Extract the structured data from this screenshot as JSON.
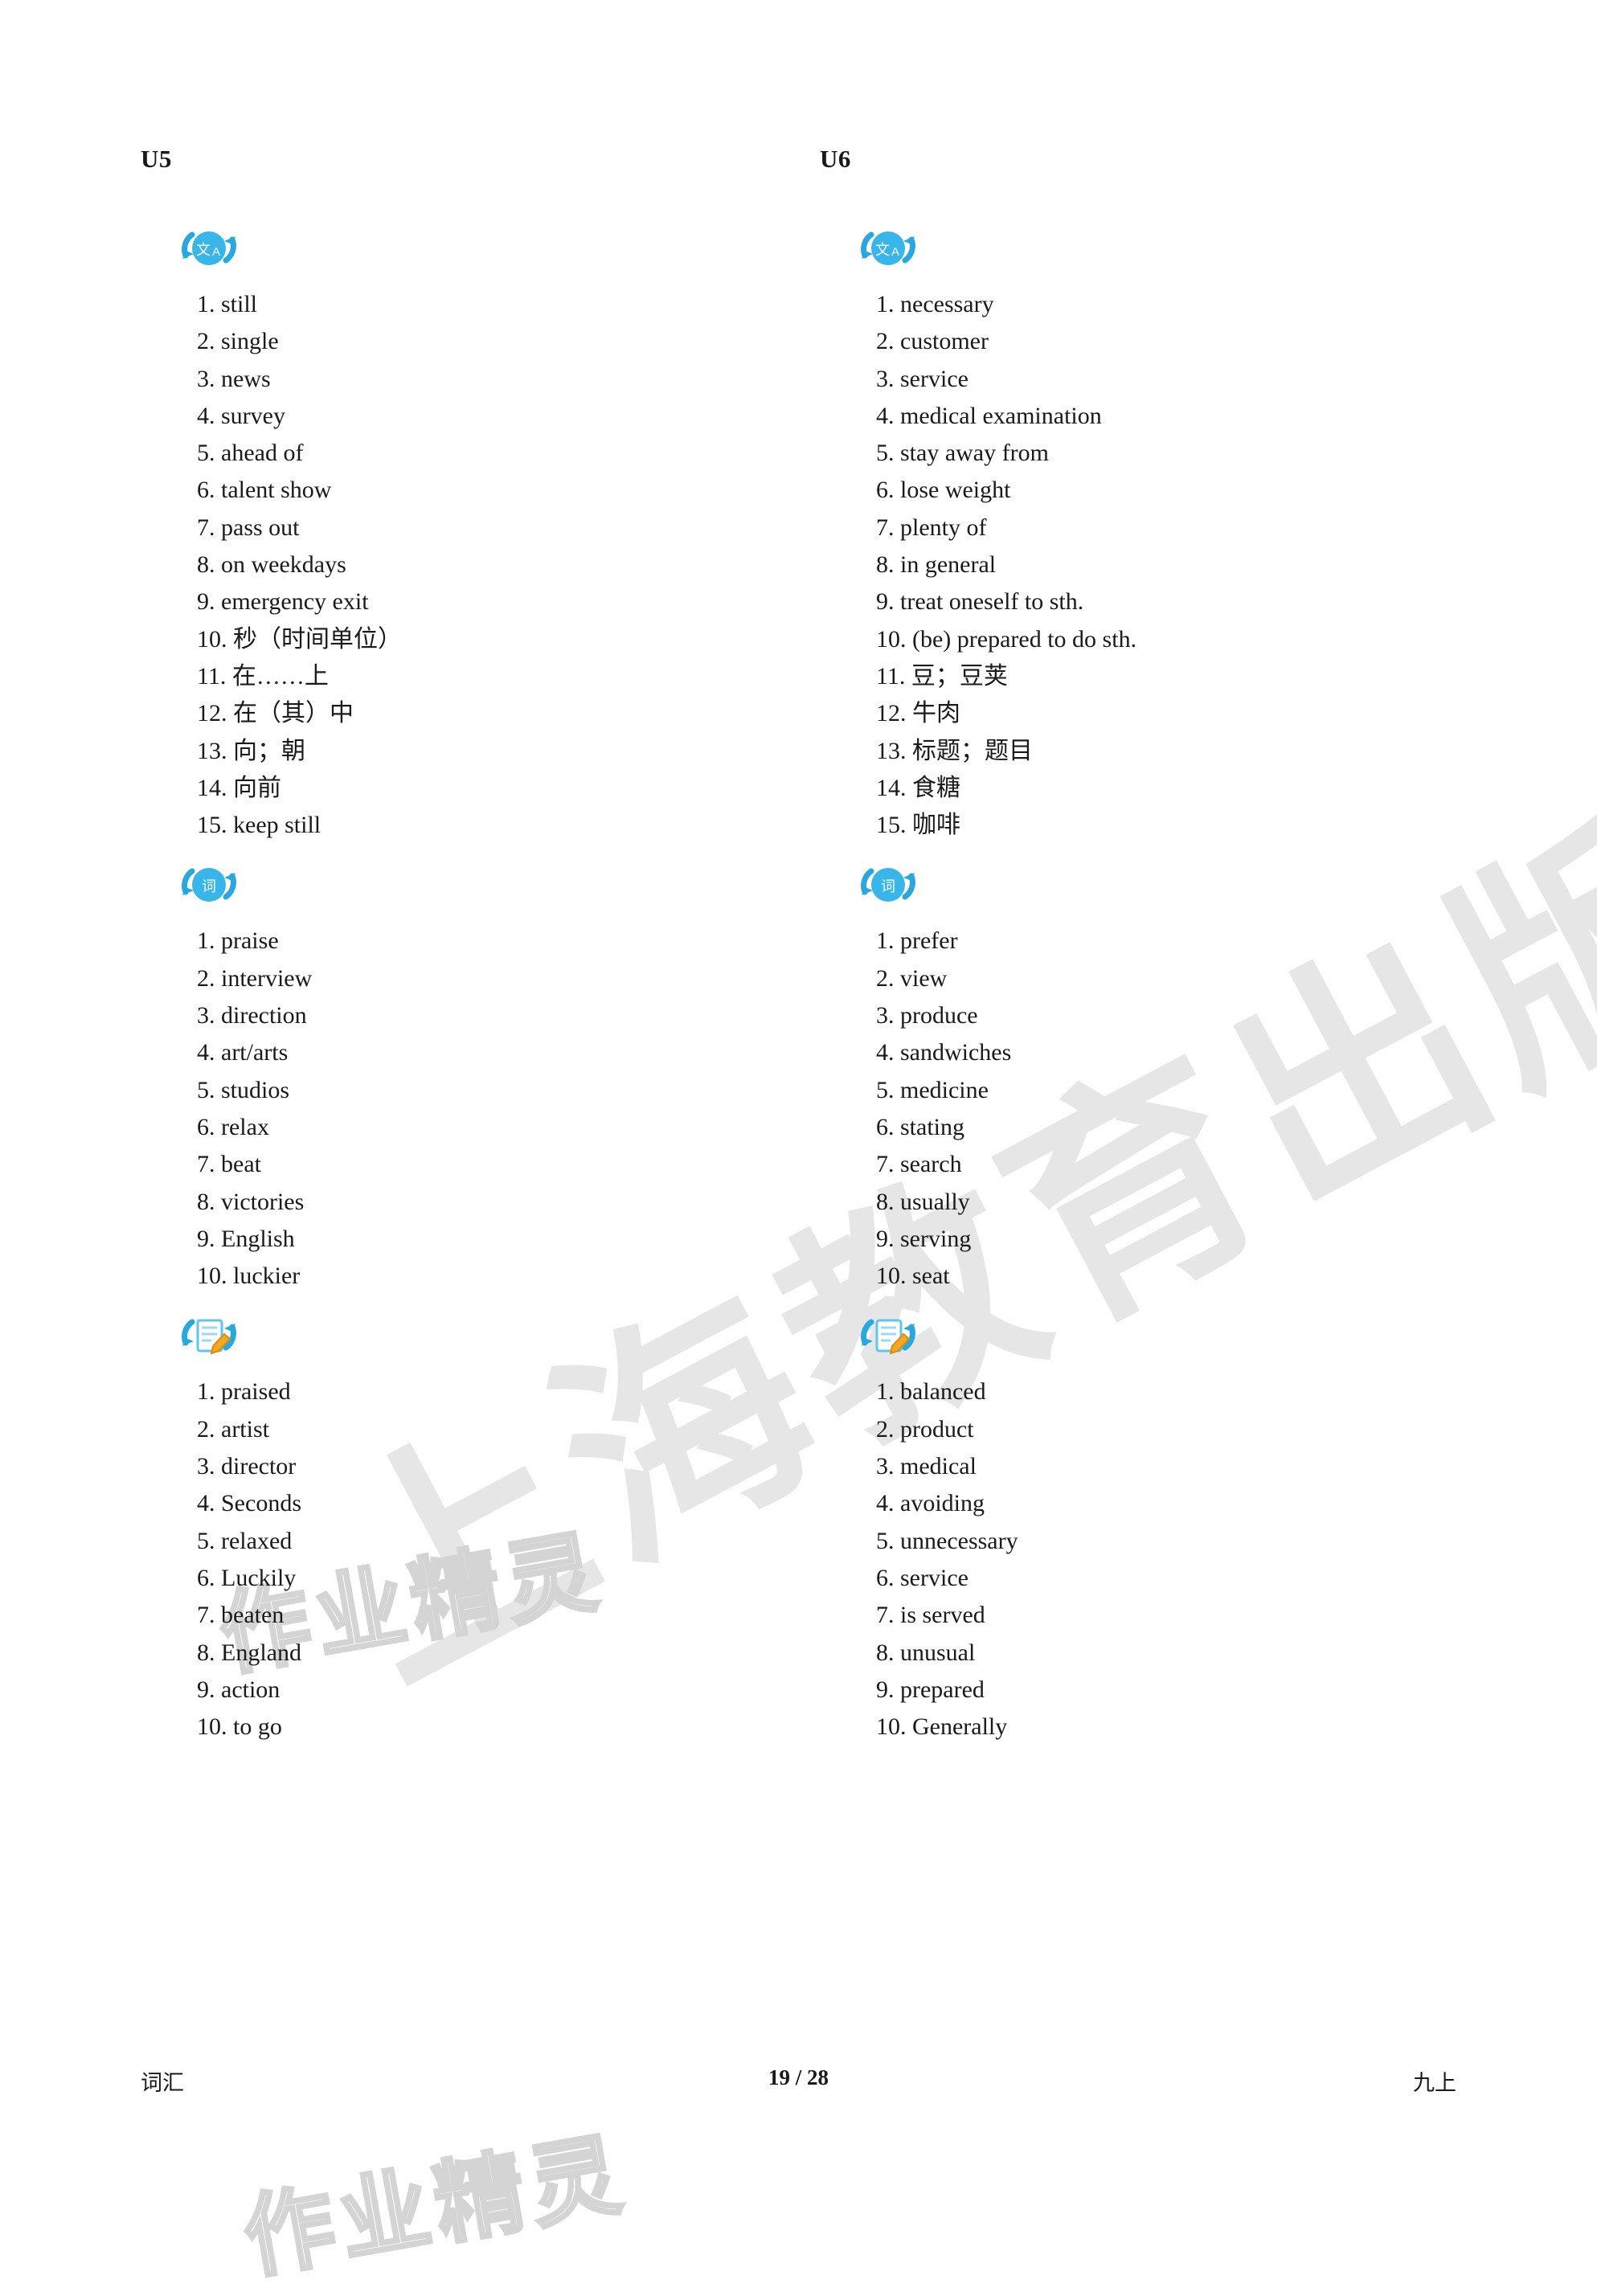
{
  "page": {
    "footer_left": "词汇",
    "footer_center": "19 / 28",
    "footer_right": "九上",
    "watermark_shanghai": "上海教育出版社",
    "watermark_brand": "作业精灵"
  },
  "columns": [
    {
      "unit": "U5",
      "sections": [
        {
          "icon": "translate-icon",
          "icon_label": "文A",
          "items": [
            "1. still",
            "2. single",
            "3. news",
            "4. survey",
            "5. ahead of",
            "6. talent show",
            "7. pass out",
            "8. on weekdays",
            "9. emergency exit",
            "10. 秒（时间单位）",
            "11. 在……上",
            "12. 在（其）中",
            "13. 向；朝",
            "14. 向前",
            "15. keep still"
          ]
        },
        {
          "icon": "word-icon",
          "icon_label": "词",
          "items": [
            "1. praise",
            "2. interview",
            "3. direction",
            "4. art/arts",
            "5. studios",
            "6. relax",
            "7. beat",
            "8. victories",
            "9. English",
            "10. luckier"
          ]
        },
        {
          "icon": "writing-icon",
          "icon_label": "",
          "items": [
            "1. praised",
            "2. artist",
            "3. director",
            "4. Seconds",
            "5. relaxed",
            "6. Luckily",
            "7. beaten",
            "8. England",
            "9. action",
            "10. to go"
          ]
        }
      ]
    },
    {
      "unit": "U6",
      "sections": [
        {
          "icon": "translate-icon",
          "icon_label": "文A",
          "items": [
            "1. necessary",
            "2. customer",
            "3. service",
            "4. medical examination",
            "5. stay away from",
            "6. lose weight",
            "7. plenty of",
            "8. in general",
            "9. treat oneself to sth.",
            "10. (be) prepared to do sth.",
            "11. 豆；豆荚",
            "12. 牛肉",
            "13. 标题；题目",
            "14. 食糖",
            "15. 咖啡"
          ]
        },
        {
          "icon": "word-icon",
          "icon_label": "词",
          "items": [
            "1. prefer",
            "2. view",
            "3. produce",
            "4. sandwiches",
            "5. medicine",
            "6. stating",
            "7. search",
            "8. usually",
            "9. serving",
            "10. seat"
          ]
        },
        {
          "icon": "writing-icon",
          "icon_label": "",
          "items": [
            "1. balanced",
            "2. product",
            "3. medical",
            "4. avoiding",
            "5. unnecessary",
            "6. service",
            "7. is served",
            "8. unusual",
            "9. prepared",
            "10. Generally"
          ]
        }
      ]
    }
  ]
}
